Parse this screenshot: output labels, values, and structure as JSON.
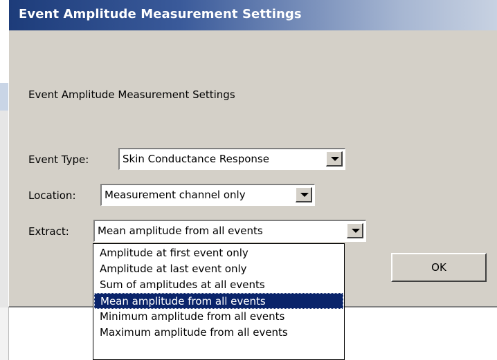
{
  "dialog": {
    "title": "Event Amplitude Measurement Settings",
    "heading": "Event Amplitude Measurement Settings",
    "ok_label": "OK"
  },
  "fields": {
    "event_type": {
      "label": "Event Type:",
      "value": "Skin Conductance Response"
    },
    "location": {
      "label": "Location:",
      "value": "Measurement channel only"
    },
    "extract": {
      "label": "Extract:",
      "value": "Mean amplitude from all events",
      "options": [
        "Amplitude at first event only",
        "Amplitude at last event only",
        "Sum of amplitudes at all events",
        "Mean amplitude from all events",
        "Minimum amplitude from all events",
        "Maximum amplitude from all events"
      ],
      "selected_index": 3
    }
  },
  "colors": {
    "dialog_bg": "#d4d0c8",
    "title_gradient_start": "#1d3c7a",
    "selection_bg": "#0a246a"
  }
}
